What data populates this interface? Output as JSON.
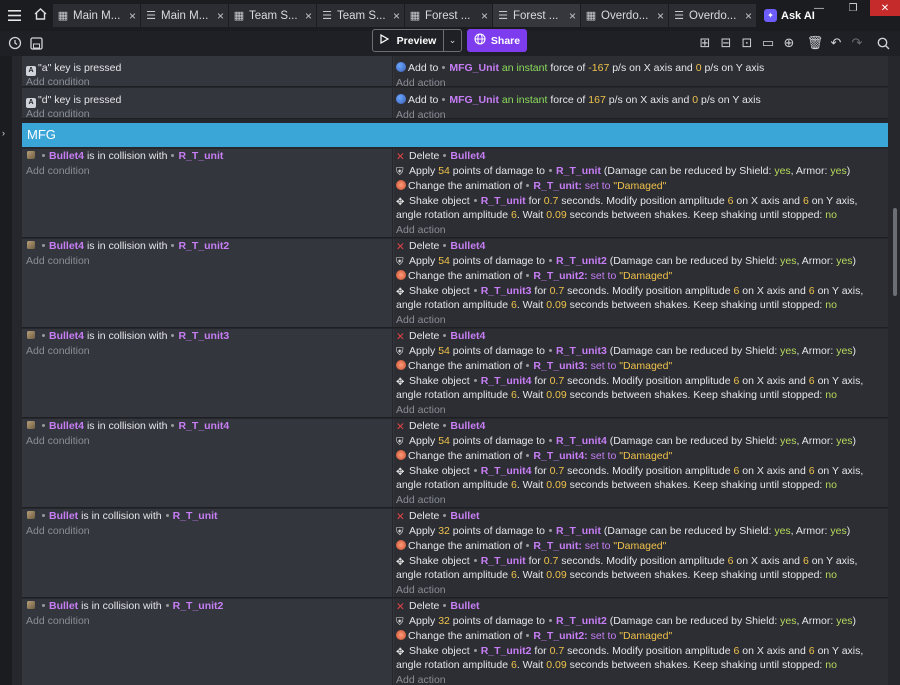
{
  "tabs": [
    {
      "label": "Main M...",
      "icon": "scene-icon",
      "active": false
    },
    {
      "label": "Main M...",
      "icon": "events-icon",
      "active": false
    },
    {
      "label": "Team S...",
      "icon": "scene-icon",
      "active": false
    },
    {
      "label": "Team S...",
      "icon": "events-icon",
      "active": false
    },
    {
      "label": "Forest ...",
      "icon": "scene-icon",
      "active": false
    },
    {
      "label": "Forest ...",
      "icon": "events-icon",
      "active": true
    },
    {
      "label": "Overdo...",
      "icon": "scene-icon",
      "active": false
    },
    {
      "label": "Overdo...",
      "icon": "events-icon",
      "active": false
    }
  ],
  "tab_close": "×",
  "askai_label": "Ask AI",
  "toolbar": {
    "preview_label": "Preview",
    "share_label": "Share"
  },
  "group_title": "MFG",
  "labels": {
    "add_condition": "Add condition",
    "add_action": "Add action",
    "key_is_pressed": "key is pressed",
    "is_in_collision_with": "is in collision with",
    "add_to": "Add to",
    "an_instant": "an instant",
    "force_of": "force of",
    "ps_on_x_axis_and": "p/s on X axis and",
    "ps_on_y_axis": "p/s on Y axis",
    "delete": "Delete",
    "apply": "Apply",
    "points_of_damage_to": "points of damage to",
    "damage_reduced_prefix": "(Damage can be reduced by Shield:",
    "armor": ", Armor:",
    "close_paren": ")",
    "change_animation_of": "Change the animation of",
    "set_to": "set to",
    "shake_object": "Shake object",
    "for": "for",
    "seconds_modify": "seconds. Modify position amplitude",
    "on_x_axis_and": "on X axis and",
    "on_y_axis_angle": "on Y axis, angle rotation amplitude",
    "wait": ". Wait",
    "seconds_between": "seconds between shakes. Keep shaking until stopped:"
  },
  "key_events": [
    {
      "key": "\"a\"",
      "object": "MFG_Unit",
      "x": "-167",
      "y": "0"
    },
    {
      "key": "\"d\"",
      "object": "MFG_Unit",
      "x": "167",
      "y": "0"
    }
  ],
  "collision_events": [
    {
      "bullet": "Bullet4",
      "target": "R_T_unit",
      "damage": "54",
      "anim_target": "R_T_unit:",
      "shake_target": "R_T_unit",
      "shield": "yes",
      "armor": "yes",
      "anim": "\"Damaged\"",
      "duration": "0.7",
      "ampx": "6",
      "ampy": "6",
      "rot": "6",
      "wait": "0.09",
      "keep": "no"
    },
    {
      "bullet": "Bullet4",
      "target": "R_T_unit2",
      "damage": "54",
      "anim_target": "R_T_unit2:",
      "shake_target": "R_T_unit3",
      "shield": "yes",
      "armor": "yes",
      "anim": "\"Damaged\"",
      "duration": "0.7",
      "ampx": "6",
      "ampy": "6",
      "rot": "6",
      "wait": "0.09",
      "keep": "no"
    },
    {
      "bullet": "Bullet4",
      "target": "R_T_unit3",
      "damage": "54",
      "anim_target": "R_T_unit3:",
      "shake_target": "R_T_unit4",
      "shield": "yes",
      "armor": "yes",
      "anim": "\"Damaged\"",
      "duration": "0.7",
      "ampx": "6",
      "ampy": "6",
      "rot": "6",
      "wait": "0.09",
      "keep": "no"
    },
    {
      "bullet": "Bullet4",
      "target": "R_T_unit4",
      "damage": "54",
      "anim_target": "R_T_unit4:",
      "shake_target": "R_T_unit4",
      "shield": "yes",
      "armor": "yes",
      "anim": "\"Damaged\"",
      "duration": "0.7",
      "ampx": "6",
      "ampy": "6",
      "rot": "6",
      "wait": "0.09",
      "keep": "no"
    },
    {
      "bullet": "Bullet",
      "target": "R_T_unit",
      "damage": "32",
      "anim_target": "R_T_unit:",
      "shake_target": "R_T_unit",
      "shield": "yes",
      "armor": "yes",
      "anim": "\"Damaged\"",
      "duration": "0.7",
      "ampx": "6",
      "ampy": "6",
      "rot": "6",
      "wait": "0.09",
      "keep": "no"
    },
    {
      "bullet": "Bullet",
      "target": "R_T_unit2",
      "damage": "32",
      "anim_target": "R_T_unit2:",
      "shake_target": "R_T_unit2",
      "shield": "yes",
      "armor": "yes",
      "anim": "\"Damaged\"",
      "duration": "0.7",
      "ampx": "6",
      "ampy": "6",
      "rot": "6",
      "wait": "0.09",
      "keep": "no"
    }
  ]
}
